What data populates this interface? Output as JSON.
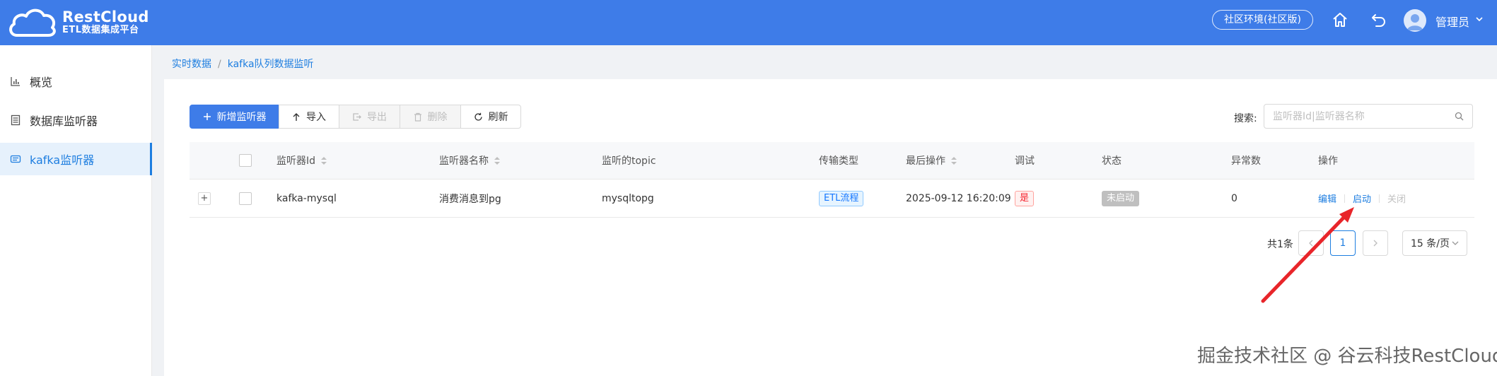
{
  "header": {
    "logo_title": "RestCloud",
    "logo_subtitle": "ETL数据集成平台",
    "env_label": "社区环境(社区版)",
    "user_name": "管理员",
    "brand_color": "#3e7ce8"
  },
  "sidebar": {
    "items": [
      {
        "label": "概览",
        "icon": "bar-chart-icon",
        "active": false
      },
      {
        "label": "数据库监听器",
        "icon": "list-icon",
        "active": false
      },
      {
        "label": "kafka监听器",
        "icon": "layers-icon",
        "active": true
      }
    ]
  },
  "breadcrumb": {
    "items": [
      "实时数据",
      "kafka队列数据监听"
    ],
    "separator": "/"
  },
  "toolbar": {
    "add_label": "新增监听器",
    "import_label": "导入",
    "export_label": "导出",
    "delete_label": "删除",
    "refresh_label": "刷新"
  },
  "search": {
    "label": "搜索:",
    "placeholder": "监听器Id|监听器名称"
  },
  "table": {
    "columns": [
      "监听器Id",
      "监听器名称",
      "监听的topic",
      "传输类型",
      "最后操作",
      "调试",
      "状态",
      "异常数",
      "操作"
    ],
    "rows": [
      {
        "id": "kafka-mysql",
        "name": "消费消息到pg",
        "topic": "mysqltopg",
        "type": "ETL流程",
        "last_op": "2025-09-12 16:20:09",
        "debug": "是",
        "status": "未启动",
        "errors": "0",
        "actions": {
          "edit": "编辑",
          "start": "启动",
          "close": "关闭"
        }
      }
    ]
  },
  "pagination": {
    "total": "共1条",
    "current_page": "1",
    "page_size": "15 条/页"
  },
  "watermark": "掘金技术社区 @ 谷云科技RestCloud"
}
